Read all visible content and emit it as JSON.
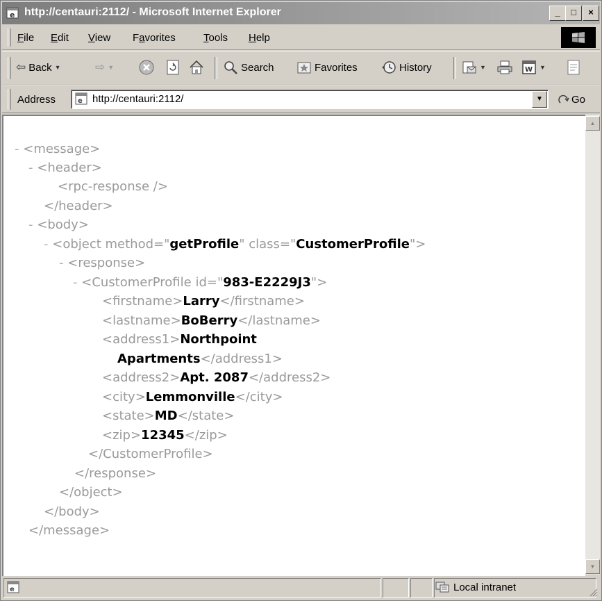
{
  "window": {
    "title": "http://centauri:2112/ - Microsoft Internet Explorer",
    "minimize": "_",
    "maximize": "□",
    "close": "×"
  },
  "menu": [
    {
      "ul": "F",
      "rest": "ile"
    },
    {
      "ul": "E",
      "rest": "dit"
    },
    {
      "ul": "V",
      "rest": "iew"
    },
    {
      "pre": "F",
      "ul": "a",
      "rest": "vorites"
    },
    {
      "ul": "T",
      "rest": "ools"
    },
    {
      "ul": "H",
      "rest": "elp"
    }
  ],
  "toolbar": {
    "back": "Back",
    "search": "Search",
    "favorites": "Favorites",
    "history": "History"
  },
  "address": {
    "label": "Address",
    "url": "http://centauri:2112/",
    "go": "Go"
  },
  "xml": {
    "message_open": "<message>",
    "header_open": "<header>",
    "rpc_response": "<rpc-response />",
    "header_close": "</header>",
    "body_open": "<body>",
    "object_open_pre": "<object method=\"",
    "object_method": "getProfile",
    "object_mid": "\" class=\"",
    "object_class": "CustomerProfile",
    "object_post": "\">",
    "response_open": "<response>",
    "cp_open_pre": "<CustomerProfile id=\"",
    "cp_id": "983-E2229J3",
    "cp_open_post": "\">",
    "firstname_open": "<firstname>",
    "firstname": "Larry",
    "firstname_close": "</firstname>",
    "lastname_open": "<lastname>",
    "lastname": "BoBerry",
    "lastname_close": "</lastname>",
    "address1_open": "<address1>",
    "address1_line1": "Northpoint",
    "address1_line2": "Apartments",
    "address1_close": "</address1>",
    "address2_open": "<address2>",
    "address2": "Apt. 2087",
    "address2_close": "</address2>",
    "city_open": "<city>",
    "city": "Lemmonville",
    "city_close": "</city>",
    "state_open": "<state>",
    "state": "MD",
    "state_close": "</state>",
    "zip_open": "<zip>",
    "zip": "12345",
    "zip_close": "</zip>",
    "cp_close": "</CustomerProfile>",
    "response_close": "</response>",
    "object_close": "</object>",
    "body_close": "</body>",
    "message_close": "</message>",
    "collapse": "-"
  },
  "status": {
    "zone": "Local intranet"
  }
}
